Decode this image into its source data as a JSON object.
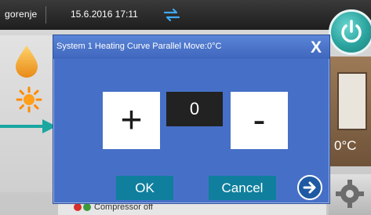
{
  "header": {
    "brand": "gorenje",
    "datetime": "15.6.2016 17:11"
  },
  "status": {
    "temperature": "0°C",
    "bottom_label": "Compressor off"
  },
  "dialog": {
    "title": "System 1 Heating Curve Parallel Move:0°C",
    "close_label": "X",
    "plus_label": "+",
    "minus_label": "-",
    "value": "0",
    "ok_label": "OK",
    "cancel_label": "Cancel"
  },
  "icons": {
    "sync": "sync-arrows-icon",
    "power": "power-icon",
    "drop": "water-drop-icon",
    "sun": "sun-icon",
    "arrow": "pointer-arrow-icon",
    "settings": "gear-icon",
    "next": "arrow-right-icon"
  },
  "colors": {
    "dialog_bg": "#4670c7",
    "button_teal": "#0f7f9d",
    "value_box": "#222222",
    "accent_cyan": "#2aa39e"
  }
}
